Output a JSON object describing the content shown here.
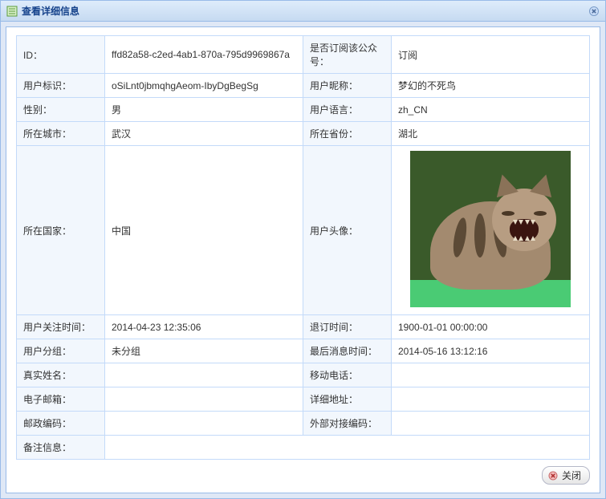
{
  "dialog": {
    "title": "查看详细信息",
    "close_button": {
      "name": "关闭"
    }
  },
  "fields": {
    "id": {
      "label": "ID：",
      "value": "ffd82a58-c2ed-4ab1-870a-795d9969867a"
    },
    "subscribed": {
      "label": "是否订阅该公众号：",
      "value": "订阅"
    },
    "user_identity": {
      "label": "用户标识：",
      "value": "oSiLnt0jbmqhgAeom-IbyDgBegSg"
    },
    "nickname": {
      "label": "用户昵称：",
      "value": "梦幻的不死鸟"
    },
    "gender": {
      "label": "性别：",
      "value": "男"
    },
    "language": {
      "label": "用户语言：",
      "value": "zh_CN"
    },
    "city": {
      "label": "所在城市：",
      "value": "武汉"
    },
    "province": {
      "label": "所在省份：",
      "value": "湖北"
    },
    "country": {
      "label": "所在国家：",
      "value": "中国"
    },
    "avatar": {
      "label": "用户头像："
    },
    "follow_time": {
      "label": "用户关注时间：",
      "value": "2014-04-23 12:35:06"
    },
    "unsubscribe_time": {
      "label": "退订时间：",
      "value": "1900-01-01 00:00:00"
    },
    "group": {
      "label": "用户分组：",
      "value": "未分组"
    },
    "last_message_time": {
      "label": "最后消息时间：",
      "value": "2014-05-16 13:12:16"
    },
    "real_name": {
      "label": "真实姓名：",
      "value": ""
    },
    "mobile": {
      "label": "移动电话：",
      "value": ""
    },
    "email": {
      "label": "电子邮箱：",
      "value": ""
    },
    "address": {
      "label": "详细地址：",
      "value": ""
    },
    "postal_code": {
      "label": "邮政编码：",
      "value": ""
    },
    "external_id": {
      "label": "外部对接编码：",
      "value": ""
    },
    "remarks": {
      "label": "备注信息：",
      "value": ""
    }
  },
  "footer": {
    "close_label": "关闭"
  }
}
